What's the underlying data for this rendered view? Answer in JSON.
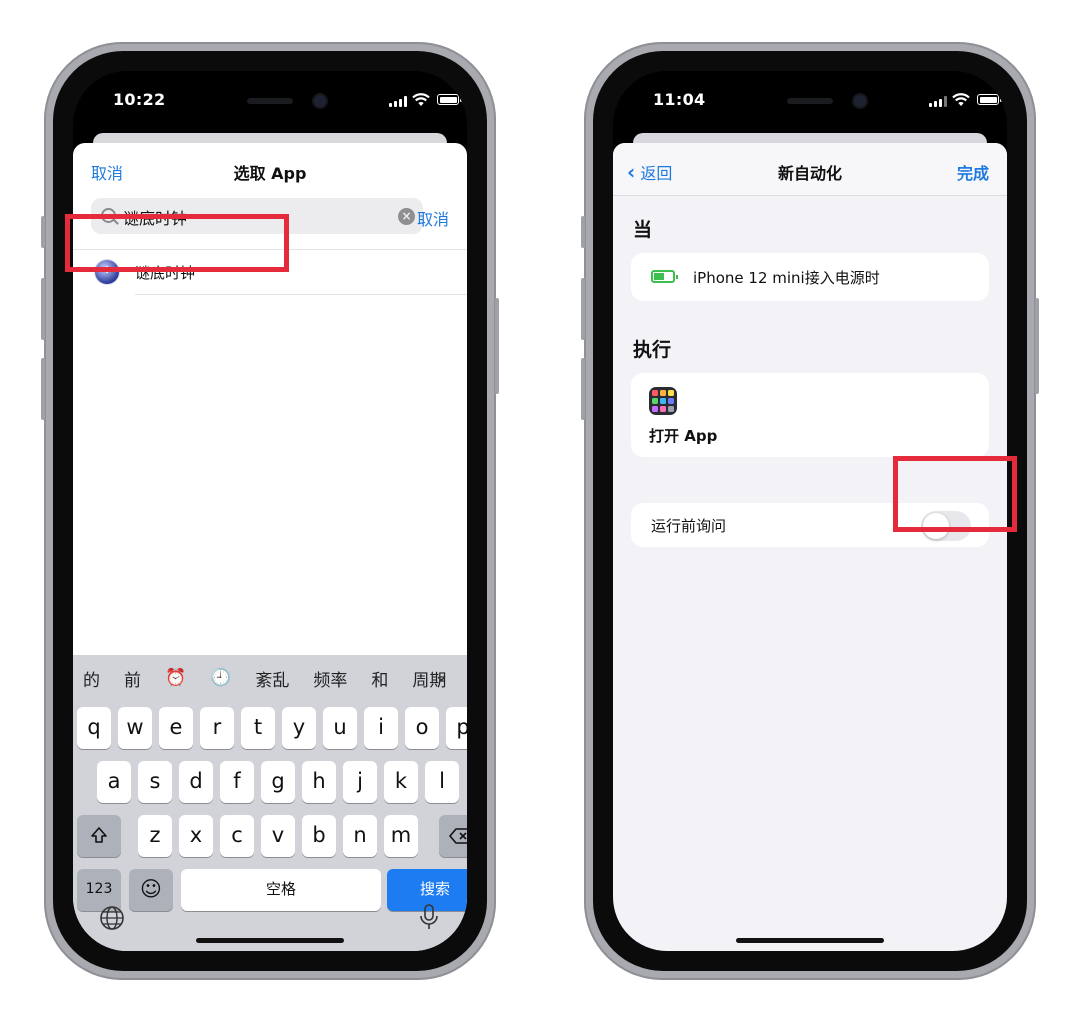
{
  "left": {
    "status": {
      "time": "10:22"
    },
    "nav": {
      "cancel": "取消",
      "title": "选取 App"
    },
    "search": {
      "value": "谜底时钟",
      "placeholder": "",
      "cancel": "取消"
    },
    "result": {
      "name": "谜底时钟"
    },
    "candidates": [
      "的",
      "前",
      "⏰",
      "🕘",
      "紊乱",
      "频率",
      "和",
      "周期"
    ],
    "candidates_expand_icon": "chevron-down-icon",
    "keys": {
      "row1": [
        "q",
        "w",
        "e",
        "r",
        "t",
        "y",
        "u",
        "i",
        "o",
        "p"
      ],
      "row2": [
        "a",
        "s",
        "d",
        "f",
        "g",
        "h",
        "j",
        "k",
        "l"
      ],
      "row3": [
        "z",
        "x",
        "c",
        "v",
        "b",
        "n",
        "m"
      ],
      "numbers": "123",
      "emoji": "☺",
      "space": "空格",
      "search": "搜索"
    },
    "highlight_color": "#e52b3b",
    "accent": "#1f7ae0"
  },
  "right": {
    "status": {
      "time": "11:04"
    },
    "nav": {
      "back": "返回",
      "title": "新自动化",
      "done": "完成"
    },
    "when_header": "当",
    "trigger": "iPhone 12 mini接入电源时",
    "do_header": "执行",
    "action": "打开 App",
    "ask_before_running": {
      "label": "运行前询问",
      "on": false
    }
  }
}
